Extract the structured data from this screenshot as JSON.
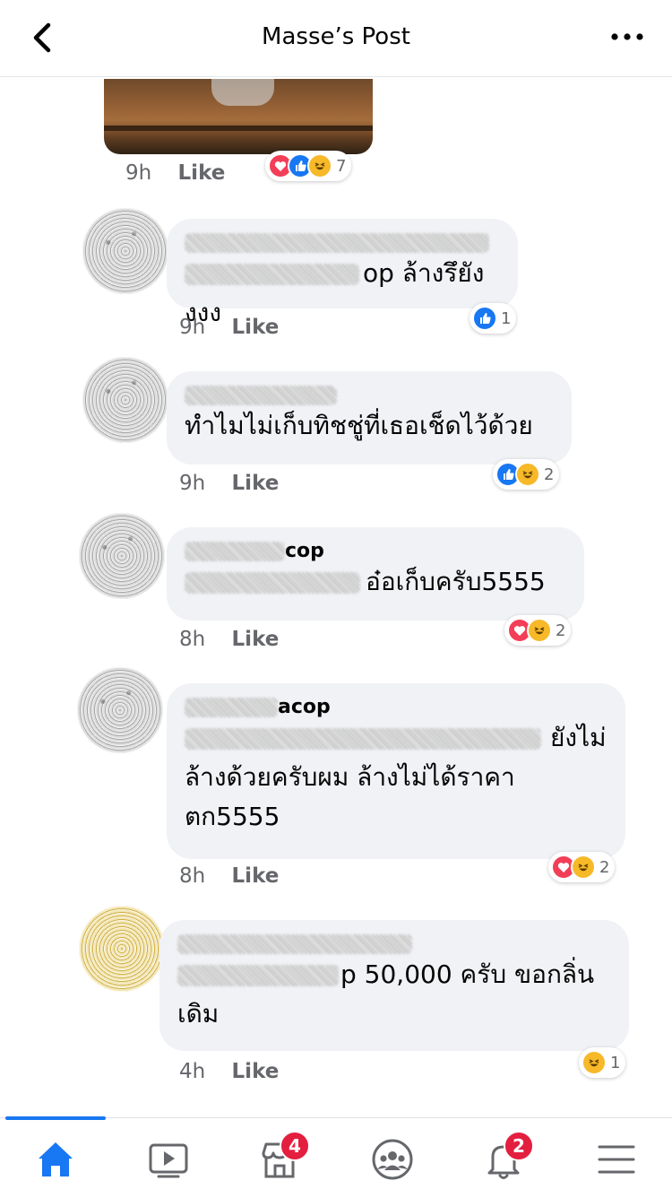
{
  "header": {
    "title": "Masse’s Post"
  },
  "post": {
    "time": "9h",
    "like_label": "Like",
    "reaction_count": "7"
  },
  "comments": [
    {
      "time": "9h",
      "like_label": "Like",
      "author_suffix": "",
      "text_line1": "op ล้างรึยังงงง",
      "reaction_count": "1"
    },
    {
      "time": "9h",
      "like_label": "Like",
      "text_line1": "ทำไมไม่เก็บทิชชู่ที่เธอเช็ดไว้ด้วย",
      "reaction_count": "2"
    },
    {
      "time": "8h",
      "like_label": "Like",
      "author_suffix": "cop",
      "text_line1": "อ๋อเก็บครับ5555",
      "reaction_count": "2"
    },
    {
      "time": "8h",
      "like_label": "Like",
      "author_suffix": "acop",
      "text_line1": "ยังไม่",
      "text_line2": "ล้างด้วยครับผม ล้างไม่ได้ราคา",
      "text_line3": "ตก5555",
      "reaction_count": "2"
    },
    {
      "time": "4h",
      "like_label": "Like",
      "text_line1": "p 50,000 ครับ ขอกลิ่น",
      "text_line2": "เดิม",
      "reaction_count": "1"
    }
  ],
  "bottom_nav": {
    "items": [
      "home-icon",
      "video-icon",
      "marketplace-icon",
      "groups-icon",
      "notifications-icon",
      "menu-icon"
    ],
    "marketplace_badge": "4",
    "notifications_badge": "2",
    "active_color": "#1877f2"
  }
}
